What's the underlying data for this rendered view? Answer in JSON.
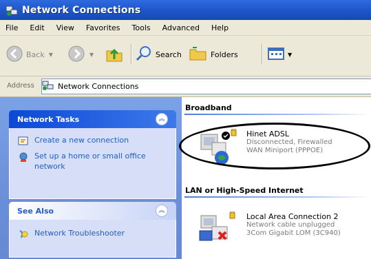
{
  "window": {
    "title": "Network Connections"
  },
  "menu": [
    "File",
    "Edit",
    "View",
    "Favorites",
    "Tools",
    "Advanced",
    "Help"
  ],
  "toolbar": {
    "back_label": "Back",
    "search_label": "Search",
    "folders_label": "Folders"
  },
  "address": {
    "label": "Address",
    "value": "Network Connections"
  },
  "tasks": {
    "network_tasks": {
      "title": "Network Tasks",
      "items": [
        "Create a new connection",
        "Set up a home or small office network"
      ]
    },
    "see_also": {
      "title": "See Also",
      "items": [
        "Network Troubleshooter"
      ]
    }
  },
  "groups": [
    {
      "title": "Broadband",
      "connections": [
        {
          "name": "Hinet ADSL",
          "status": "Disconnected, Firewalled",
          "device": "WAN Miniport (PPPOE)"
        }
      ]
    },
    {
      "title": "LAN or High-Speed Internet",
      "connections": [
        {
          "name": "Local Area Connection 2",
          "status": "Network cable unplugged",
          "device": "3Com Gigabit LOM (3C940)"
        }
      ]
    }
  ],
  "colors": {
    "titlebar": "#1f56c9",
    "taskpane": "#7ba2e7",
    "link": "#215dc6",
    "annotation": "#000000"
  }
}
